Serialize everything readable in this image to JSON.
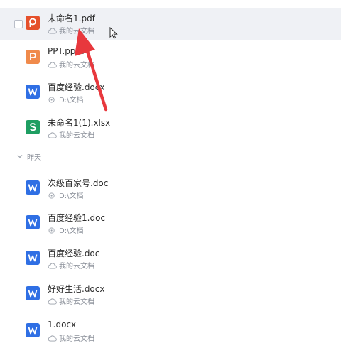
{
  "group_yesterday_label": "昨天",
  "files": [
    {
      "name": "未命名1.pdf",
      "location": "我的云文档",
      "type": "pdf",
      "icon": "pdf-file-icon",
      "loc_icon": "cloud-icon",
      "selected": true
    },
    {
      "name": "PPT.pptx",
      "location": "我的云文档",
      "type": "ppt",
      "icon": "ppt-file-icon",
      "loc_icon": "cloud-icon"
    },
    {
      "name": "百度经验.docx",
      "location": "D:\\文档",
      "type": "doc",
      "icon": "word-file-icon",
      "loc_icon": "disk-icon"
    },
    {
      "name": "未命名1(1).xlsx",
      "location": "我的云文档",
      "type": "xls",
      "icon": "excel-file-icon",
      "loc_icon": "cloud-icon"
    },
    {
      "name": "次级百家号.doc",
      "location": "D:\\文档",
      "type": "doc",
      "icon": "word-file-icon",
      "loc_icon": "disk-icon"
    },
    {
      "name": "百度经验1.doc",
      "location": "D:\\文档",
      "type": "doc",
      "icon": "word-file-icon",
      "loc_icon": "disk-icon"
    },
    {
      "name": "百度经验.doc",
      "location": "我的云文档",
      "type": "doc",
      "icon": "word-file-icon",
      "loc_icon": "cloud-icon"
    },
    {
      "name": "好好生活.docx",
      "location": "我的云文档",
      "type": "doc",
      "icon": "word-file-icon",
      "loc_icon": "cloud-icon"
    },
    {
      "name": "1.docx",
      "location": "我的云文档",
      "type": "doc",
      "icon": "word-file-icon",
      "loc_icon": "cloud-icon"
    }
  ],
  "colors": {
    "pdf": "#e5502b",
    "ppt": "#f08a4b",
    "doc": "#2f6fe4",
    "xls": "#1e9e62",
    "selected_row": "#eff1f5",
    "annotation_arrow": "#e8383d"
  }
}
